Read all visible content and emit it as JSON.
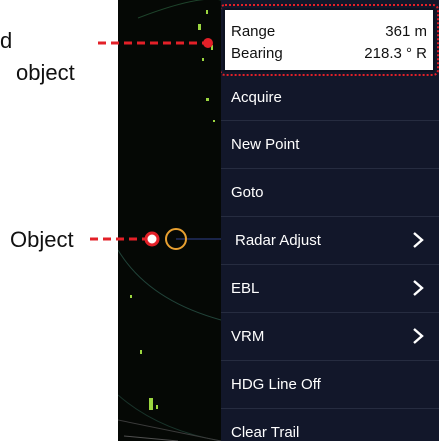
{
  "callouts": {
    "top_line1": "d",
    "top_line2": "object",
    "object_label": "Object"
  },
  "info": {
    "range_label": "Range",
    "range_value": "361 m",
    "bearing_label": "Bearing",
    "bearing_value": "218.3 ° R"
  },
  "menu": {
    "items": [
      {
        "label": "Acquire"
      },
      {
        "label": "New Point"
      },
      {
        "label": "Goto"
      },
      {
        "label": "Radar Adjust"
      },
      {
        "label": "EBL"
      },
      {
        "label": "VRM"
      },
      {
        "label": "HDG Line Off"
      },
      {
        "label": "Clear Trail"
      }
    ]
  },
  "colors": {
    "menu_bg": "#12172a",
    "callout_red": "#e32028",
    "radar_bg": "#050805",
    "echo_green": "#9bd640",
    "target_orange": "#e8a030"
  },
  "icons": {
    "chevron": "chevron-right-icon",
    "target": "target-circle-icon"
  }
}
